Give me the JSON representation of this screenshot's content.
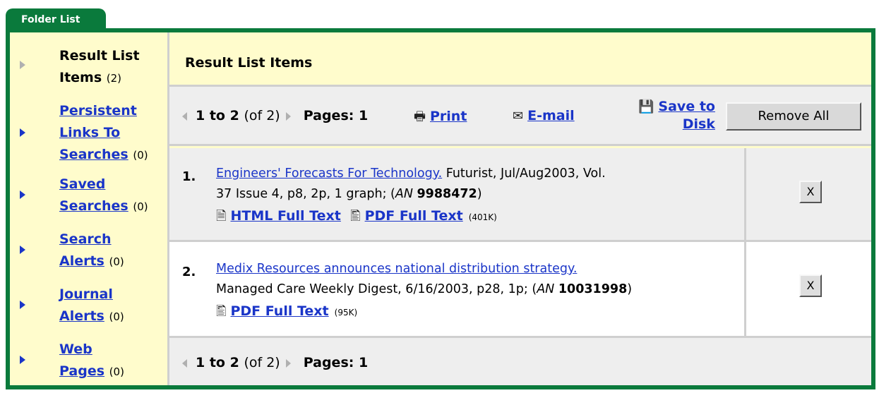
{
  "tab": {
    "label": "Folder List"
  },
  "sidebar": {
    "items": [
      {
        "label_line1": "Result List",
        "label_line2": "Items",
        "count": "(2)",
        "active": true
      },
      {
        "label_line1": "Persistent",
        "label_line2": "Links To",
        "label_line3": "Searches",
        "count": "(0)"
      },
      {
        "label_line1": "Saved",
        "label_line2": "Searches",
        "count": "(0)"
      },
      {
        "label_line1": "Search",
        "label_line2": "Alerts",
        "count": "(0)"
      },
      {
        "label_line1": "Journal",
        "label_line2": "Alerts",
        "count": "(0)"
      },
      {
        "label_line1": "Web",
        "label_line2": "Pages",
        "count": "(0)"
      }
    ]
  },
  "main": {
    "header_title": "Result List Items",
    "pager": {
      "range": "1 to 2",
      "of": "(of 2)",
      "pages_label": "Pages:",
      "pages_value": "1"
    },
    "toolbar": {
      "print_label": "Print",
      "email_label": "E-mail",
      "save_line1": "Save to",
      "save_line2": "Disk",
      "remove_all_label": "Remove All"
    },
    "results": [
      {
        "number": "1.",
        "title": "Engineers' Forecasts For Technology.",
        "source_line1": " Futurist, Jul/Aug2003, Vol.",
        "source_line2": "37 Issue 4, p8, 2p, 1 graph; (",
        "an_label": "AN",
        "an_value": "9988472",
        "an_close": ")",
        "html_link": "HTML Full Text",
        "pdf_link": "PDF Full Text",
        "pdf_size": "(401K)",
        "remove_label": "X"
      },
      {
        "number": "2.",
        "title": "Medix Resources announces national distribution strategy.",
        "source_line1": "",
        "source_line2": "Managed Care Weekly Digest, 6/16/2003, p28, 1p; (",
        "an_label": "AN",
        "an_value": "10031998",
        "an_close": ")",
        "pdf_link": "PDF Full Text",
        "pdf_size": "(95K)",
        "remove_label": "X"
      }
    ]
  },
  "colors": {
    "accent_green": "#0a7a3c",
    "link_blue": "#1a35c8",
    "sidebar_bg": "#fffccc",
    "row_gray": "#eeeeee"
  }
}
